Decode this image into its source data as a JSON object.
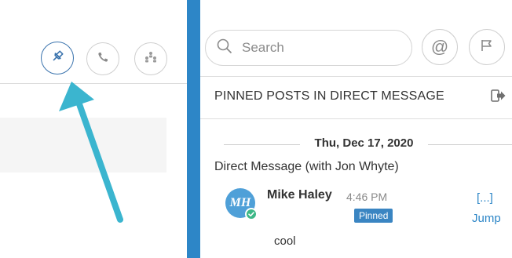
{
  "channel_header": {
    "buttons": [
      {
        "name": "pinned",
        "icon": "pin-icon",
        "active": true
      },
      {
        "name": "call",
        "icon": "phone-icon",
        "active": false
      },
      {
        "name": "members",
        "icon": "members-icon",
        "active": false
      }
    ]
  },
  "search": {
    "placeholder": "Search"
  },
  "rhs": {
    "title": "PINNED POSTS IN DIRECT MESSAGE",
    "date_separator": "Thu, Dec 17, 2020",
    "channel_name": "Direct Message (with Jon Whyte)",
    "post": {
      "avatar_initials": "MH",
      "author": "Mike Haley",
      "time": "4:46 PM",
      "badge": "Pinned",
      "dots_link": "[...]",
      "jump_link": "Jump",
      "message": "cool"
    }
  },
  "colors": {
    "divider": "#2d86c7",
    "arrow": "#3bb5cf",
    "link": "#2d86c7",
    "badge": "#3a85c2",
    "avatar": "#4fa0d8",
    "online": "#3db887"
  }
}
